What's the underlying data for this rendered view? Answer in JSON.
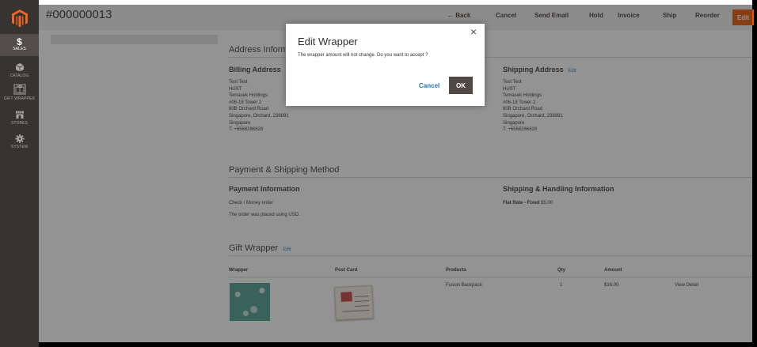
{
  "header": {
    "order_number": "#000000013",
    "back_label": "← Back",
    "cancel_label": "Cancel",
    "send_email_label": "Send Email",
    "hold_label": "Hold",
    "invoice_label": "Invoice",
    "ship_label": "Ship",
    "reorder_label": "Reorder",
    "edit_label": "Edit"
  },
  "sidebar": {
    "items": [
      {
        "label": "SALES",
        "icon": "dollar-icon",
        "glyph": "$"
      },
      {
        "label": "CATALOG",
        "icon": "cube-icon"
      },
      {
        "label": "GIFT WRAPPER",
        "icon": "gift-icon"
      },
      {
        "label": "STORES",
        "icon": "store-icon"
      },
      {
        "label": "SYSTEM",
        "icon": "gear-icon"
      }
    ]
  },
  "address": {
    "section_title": "Address Information",
    "billing": {
      "title": "Billing Address",
      "lines": "Test Test\nHUST\nTemasek Holdings\n#06-18 Tower 2\n60B Orchard Road\nSingapore, Orchard, 238891\nSingapore\nT: +6568286828"
    },
    "shipping": {
      "title": "Shipping Address",
      "edit_label": "Edit",
      "lines": "Test Test\nHUST\nTemasek Holdings\n#06-18 Tower 2\n60B Orchard Road\nSingapore, Orchard, 238891\nSingapore\nT: +6568286828"
    }
  },
  "payment": {
    "section_title": "Payment & Shipping Method",
    "payment_title": "Payment Information",
    "method": "Check / Money order",
    "currency_note": "The order was placed using USD.",
    "shipping_title": "Shipping & Handling Information",
    "shipping_method": "Flat Rate - Fixed",
    "shipping_price": "$5.00"
  },
  "gift_wrapper": {
    "section_title": "Gift Wrapper",
    "edit_label": "Edit",
    "columns": [
      "Wrapper",
      "Post Card",
      "Products",
      "Qty",
      "Amount"
    ],
    "row": {
      "product": "Fusion Backpack",
      "qty": "1",
      "amount": "$16.00",
      "view_detail": "View Detail"
    }
  },
  "modal": {
    "title": "Edit Wrapper",
    "message": "The wrapper amount will not change. Do you want to accept ?",
    "cancel_label": "Cancel",
    "ok_label": "OK",
    "close_glyph": "×"
  },
  "colors": {
    "sidebar_bg": "#373330",
    "accent": "#eb5202",
    "link": "#1979c3",
    "primary_button": "#514943"
  }
}
